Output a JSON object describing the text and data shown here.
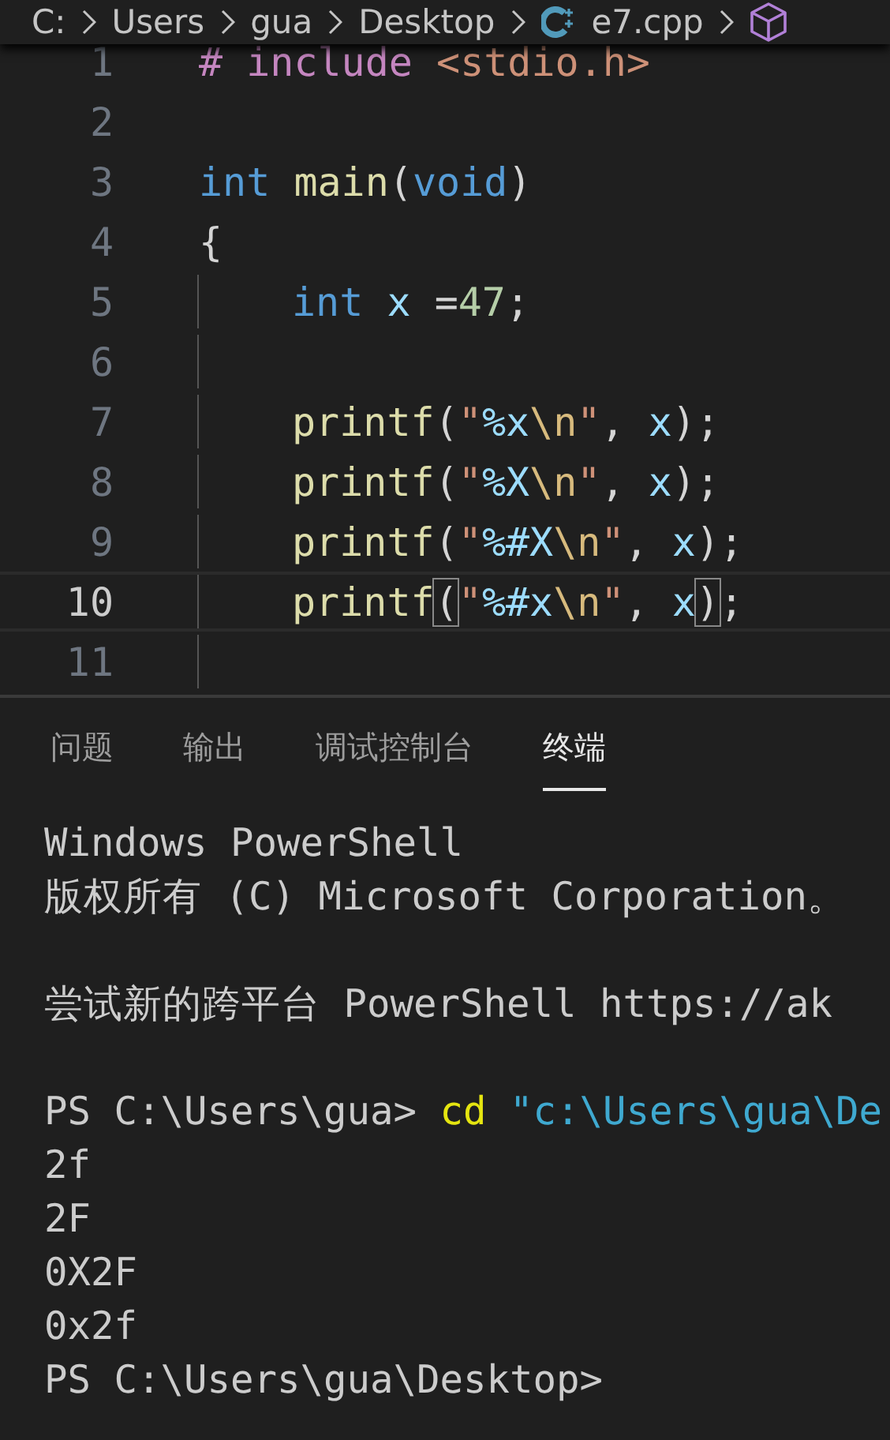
{
  "breadcrumb": [
    {
      "label": "C:",
      "kind": "folder"
    },
    {
      "label": "Users",
      "kind": "folder"
    },
    {
      "label": "gua",
      "kind": "folder"
    },
    {
      "label": "Desktop",
      "kind": "folder"
    },
    {
      "label": "e7.cpp",
      "kind": "cpp-file"
    },
    {
      "kind": "symbol"
    }
  ],
  "editor": {
    "lines": [
      {
        "number": "1",
        "current": false,
        "guide": false,
        "indented": false,
        "tokens": [
          {
            "text": "# include",
            "kind": "preproc"
          },
          {
            "text": " <stdio.h>",
            "kind": "string"
          }
        ]
      },
      {
        "number": "2",
        "current": false,
        "guide": false,
        "indented": false
      },
      {
        "number": "3",
        "current": false,
        "guide": false,
        "indented": false,
        "tokens": [
          {
            "text": "int",
            "kind": "keyword"
          },
          {
            "text": " main",
            "kind": "function"
          },
          {
            "text": "(",
            "kind": "plain"
          },
          {
            "text": "void",
            "kind": "keyword"
          },
          {
            "text": ")",
            "kind": "plain"
          }
        ]
      },
      {
        "number": "4",
        "current": false,
        "guide": false,
        "indented": false,
        "tokens": [
          {
            "text": "{",
            "kind": "plain"
          }
        ]
      },
      {
        "number": "5",
        "current": false,
        "guide": true,
        "indented": true,
        "tokens": [
          {
            "text": "int",
            "kind": "keyword"
          },
          {
            "text": " x",
            "kind": "variable"
          },
          {
            "text": " =",
            "kind": "plain"
          },
          {
            "text": "47",
            "kind": "number"
          },
          {
            "text": ";",
            "kind": "plain"
          }
        ]
      },
      {
        "number": "6",
        "current": false,
        "guide": true,
        "indented": false
      },
      {
        "number": "7",
        "current": false,
        "guide": true,
        "indented": true,
        "tokens": [
          {
            "text": "printf",
            "kind": "function"
          },
          {
            "text": "(",
            "kind": "plain"
          },
          {
            "text": "\"",
            "kind": "string"
          },
          {
            "text": "%x",
            "kind": "variable"
          },
          {
            "text": "\\n",
            "kind": "escape"
          },
          {
            "text": "\"",
            "kind": "string"
          },
          {
            "text": ", ",
            "kind": "plain"
          },
          {
            "text": "x",
            "kind": "variable"
          },
          {
            "text": ");",
            "kind": "plain"
          }
        ]
      },
      {
        "number": "8",
        "current": false,
        "guide": true,
        "indented": true,
        "tokens": [
          {
            "text": "printf",
            "kind": "function"
          },
          {
            "text": "(",
            "kind": "plain"
          },
          {
            "text": "\"",
            "kind": "string"
          },
          {
            "text": "%X",
            "kind": "variable"
          },
          {
            "text": "\\n",
            "kind": "escape"
          },
          {
            "text": "\"",
            "kind": "string"
          },
          {
            "text": ", ",
            "kind": "plain"
          },
          {
            "text": "x",
            "kind": "variable"
          },
          {
            "text": ");",
            "kind": "plain"
          }
        ]
      },
      {
        "number": "9",
        "current": false,
        "guide": true,
        "indented": true,
        "tokens": [
          {
            "text": "printf",
            "kind": "function"
          },
          {
            "text": "(",
            "kind": "plain"
          },
          {
            "text": "\"",
            "kind": "string"
          },
          {
            "text": "%#X",
            "kind": "variable"
          },
          {
            "text": "\\n",
            "kind": "escape"
          },
          {
            "text": "\"",
            "kind": "string"
          },
          {
            "text": ", ",
            "kind": "plain"
          },
          {
            "text": "x",
            "kind": "variable"
          },
          {
            "text": ");",
            "kind": "plain"
          }
        ]
      },
      {
        "number": "10",
        "current": true,
        "guide": true,
        "indented": true,
        "tokens": [
          {
            "text": "printf",
            "kind": "function"
          },
          {
            "text": "(",
            "kind": "bracket"
          },
          {
            "text": "\"",
            "kind": "string"
          },
          {
            "text": "%#x",
            "kind": "variable"
          },
          {
            "text": "\\n",
            "kind": "escape"
          },
          {
            "text": "\"",
            "kind": "string"
          },
          {
            "text": ", ",
            "kind": "plain"
          },
          {
            "text": "x",
            "kind": "variable"
          },
          {
            "text": ")",
            "kind": "bracket"
          },
          {
            "text": ";",
            "kind": "plain"
          }
        ]
      },
      {
        "number": "11",
        "current": false,
        "guide": true,
        "indented": false
      }
    ]
  },
  "panel": {
    "tabs": [
      {
        "label": "问题",
        "selected": false
      },
      {
        "label": "输出",
        "selected": false
      },
      {
        "label": "调试控制台",
        "selected": false
      },
      {
        "label": "终端",
        "selected": true
      }
    ],
    "terminal": [
      {
        "kind": "output",
        "tokens": [
          {
            "text": "Windows PowerShell",
            "kind": "plain"
          }
        ]
      },
      {
        "kind": "output",
        "tokens": [
          {
            "text": "版权所有 (C) Microsoft Corporation。",
            "kind": "plain"
          }
        ]
      },
      {
        "kind": "blank"
      },
      {
        "kind": "output",
        "tokens": [
          {
            "text": "尝试新的跨平台 PowerShell https://ak",
            "kind": "plain"
          }
        ]
      },
      {
        "kind": "blank"
      },
      {
        "kind": "output",
        "tokens": [
          {
            "text": "PS C:\\Users\\gua> ",
            "kind": "plain"
          },
          {
            "text": "cd",
            "kind": "command"
          },
          {
            "text": " \"c:\\Users\\gua\\De",
            "kind": "argument"
          }
        ]
      },
      {
        "kind": "output",
        "tokens": [
          {
            "text": "2f",
            "kind": "plain"
          }
        ]
      },
      {
        "kind": "output",
        "tokens": [
          {
            "text": "2F",
            "kind": "plain"
          }
        ]
      },
      {
        "kind": "output",
        "tokens": [
          {
            "text": "0X2F",
            "kind": "plain"
          }
        ]
      },
      {
        "kind": "output",
        "tokens": [
          {
            "text": "0x2f",
            "kind": "plain"
          }
        ]
      },
      {
        "kind": "output",
        "tokens": [
          {
            "text": "PS C:\\Users\\gua\\Desktop>",
            "kind": "plain"
          }
        ]
      }
    ]
  }
}
